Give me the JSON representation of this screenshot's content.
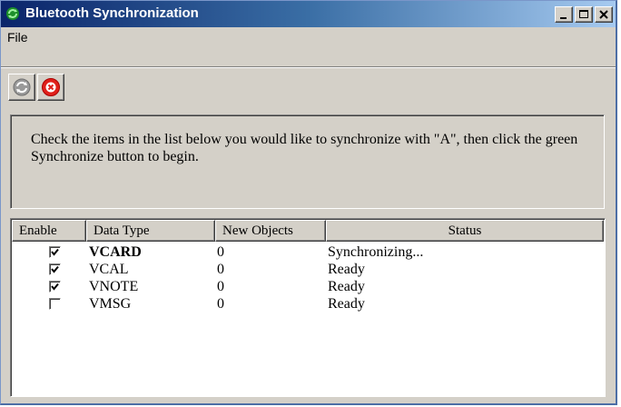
{
  "window": {
    "title": "Bluetooth Synchronization"
  },
  "menu": {
    "file": "File"
  },
  "toolbar": {
    "sync_icon": "sync-arrows-icon",
    "stop_icon": "stop-x-icon"
  },
  "info_text": "Check the items in the list below you would like to synchronize with \"A\", then click the green Synchronize button to begin.",
  "table": {
    "columns": [
      "Enable",
      "Data Type",
      "New Objects",
      "Status"
    ],
    "rows": [
      {
        "enabled": true,
        "type": "VCARD",
        "new_objects": "0",
        "status": "Synchronizing..."
      },
      {
        "enabled": true,
        "type": "VCAL",
        "new_objects": "0",
        "status": "Ready"
      },
      {
        "enabled": true,
        "type": "VNOTE",
        "new_objects": "0",
        "status": "Ready"
      },
      {
        "enabled": false,
        "type": "VMSG",
        "new_objects": "0",
        "status": "Ready"
      }
    ]
  },
  "colors": {
    "title_start": "#0a246a",
    "title_end": "#a6caf0",
    "stop_red": "#e0201a",
    "sync_grey": "#8a8a8a"
  }
}
